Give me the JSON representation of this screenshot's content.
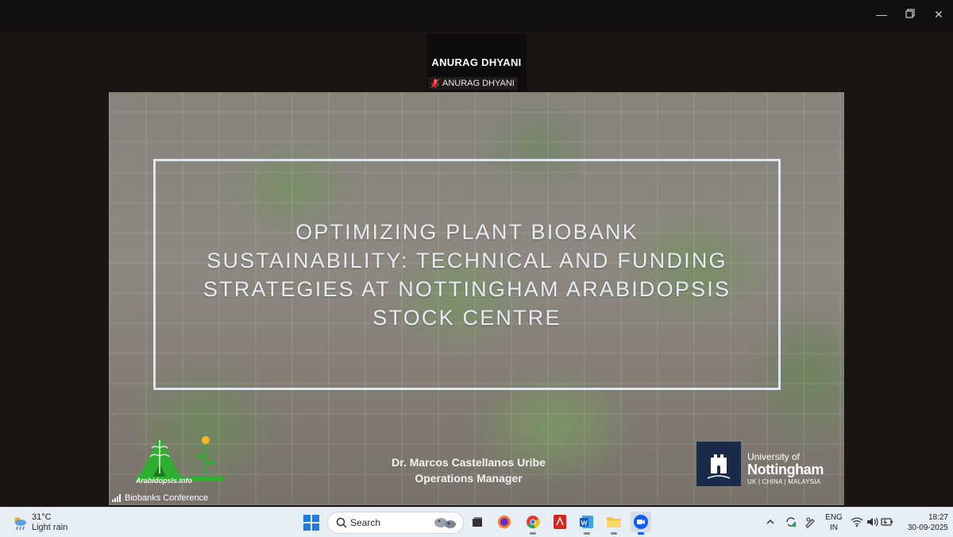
{
  "meeting": {
    "speaker_name": "ANURAG DHYANI",
    "speaker_label": "ANURAG DHYANI"
  },
  "slide": {
    "title": "OPTIMIZING PLANT BIOBANK\nSUSTAINABILITY: TECHNICAL AND FUNDING\nSTRATEGIES AT NOTTINGHAM ARABIDOPSIS\nSTOCK CENTRE",
    "presenter_name": "Dr. Marcos Castellanos Uribe",
    "presenter_role": "Operations Manager",
    "left_logo_text": "Arabidopsis.info",
    "right_logo": {
      "line1": "University of",
      "line2": "Nottingham",
      "line3": "UK | CHINA | MALAYSIA"
    },
    "conference_label": "Biobanks Conference"
  },
  "taskbar": {
    "weather": {
      "temp": "31°C",
      "condition": "Light rain"
    },
    "search_placeholder": "Search",
    "language": {
      "line1": "ENG",
      "line2": "IN"
    },
    "clock": {
      "time": "18:27",
      "date": "30-09-2025"
    }
  },
  "colors": {
    "title_text": "#e6ecf1",
    "uon_navy": "#1b2a4a",
    "taskbar_bg": "#e7eef6"
  }
}
